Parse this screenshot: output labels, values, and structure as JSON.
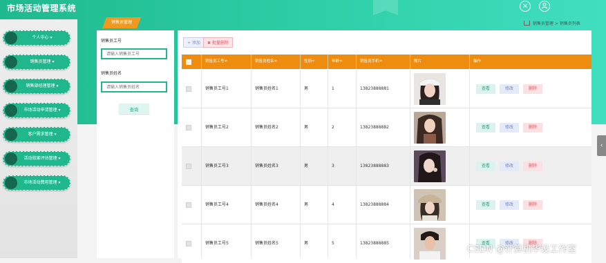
{
  "app": {
    "title": "市场活动管理系统"
  },
  "header": {
    "icons": [
      "close-circle-icon",
      "user-icon"
    ]
  },
  "sidebar": {
    "items": [
      {
        "label": "个人中心 ▾"
      },
      {
        "label": "销售员管理 ▾"
      },
      {
        "label": "销售部经理管理 ▾"
      },
      {
        "label": "市场活动申请管理 ▾"
      },
      {
        "label": "客户需求管理 ▾"
      },
      {
        "label": "活动效果评估管理 ▾"
      },
      {
        "label": "市场活动费用管理 ▾"
      }
    ]
  },
  "tab": {
    "label": "销售员管理"
  },
  "breadcrumb": {
    "home": "销售员管理",
    "separator": ">",
    "current": "销售员列表"
  },
  "filter": {
    "field1_label": "销售员工号",
    "field1_placeholder": "请输入销售员工号",
    "field2_label": "销售员姓名",
    "field2_placeholder": "请输入销售员姓名",
    "search_label": "查询"
  },
  "toolbar": {
    "add_label": "+ 添加",
    "batch_delete_label": "✖ 批量删除"
  },
  "table": {
    "headers": [
      "销售员工号≑",
      "销售员姓名≑",
      "性别≑",
      "年龄≑",
      "销售员手机≑",
      "照片",
      "操作"
    ],
    "rows": [
      {
        "id": "销售员工号1",
        "name": "销售员姓名1",
        "gender": "男",
        "age": "1",
        "phone": "13823888881"
      },
      {
        "id": "销售员工号2",
        "name": "销售员姓名2",
        "gender": "男",
        "age": "2",
        "phone": "13823888882"
      },
      {
        "id": "销售员工号3",
        "name": "销售员姓名3",
        "gender": "男",
        "age": "3",
        "phone": "13823888883"
      },
      {
        "id": "销售员工号4",
        "name": "销售员姓名4",
        "gender": "男",
        "age": "4",
        "phone": "13823888884"
      },
      {
        "id": "销售员工号5",
        "name": "销售员姓名5",
        "gender": "男",
        "age": "5",
        "phone": "13823888885"
      }
    ],
    "actions": {
      "view": "查看",
      "edit": "修改",
      "delete": "删除"
    }
  },
  "collapse": {
    "icon": "‹"
  },
  "watermark": {
    "text": "CSDN @计算机毕设工作室"
  },
  "colors": {
    "primary": "#21b78c",
    "header_orange": "#ee8c10",
    "tab_orange": "#ef9a1f",
    "danger": "#e25564"
  }
}
